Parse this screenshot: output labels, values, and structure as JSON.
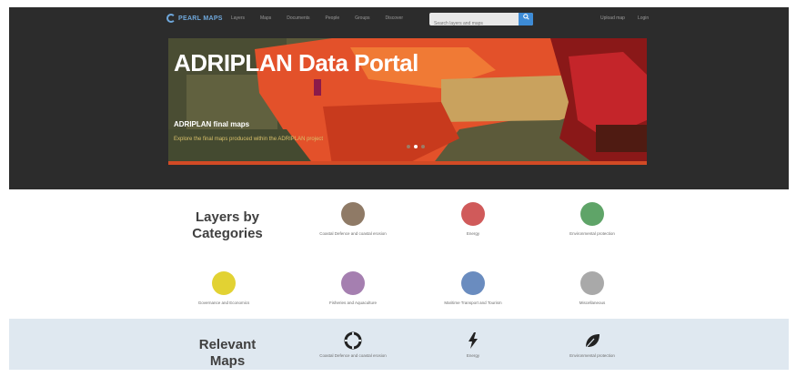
{
  "brand": {
    "name": "PEARL MAPS"
  },
  "nav": {
    "items": [
      "Layers",
      "Maps",
      "Documents",
      "People",
      "Groups",
      "Discover"
    ]
  },
  "search": {
    "placeholder": "Search layers and maps",
    "icon": "search-icon"
  },
  "user_links": [
    "Upload map",
    "Login"
  ],
  "hero": {
    "title": "ADRIPLAN Data Portal",
    "subtitle": "ADRIPLAN final maps",
    "caption": "Explore the final maps produced within the ADRIPLAN project",
    "slides_count": 3,
    "active_slide": 2
  },
  "categories": {
    "title_line1": "Layers by",
    "title_line2": "Categories",
    "items": [
      {
        "label": "Coastal Defence and coastal erosion",
        "color": "#8f7a66"
      },
      {
        "label": "Energy",
        "color": "#d05a5a"
      },
      {
        "label": "Environmental protection",
        "color": "#5fa468"
      },
      {
        "label": "Governance and Economics",
        "color": "#e2d233"
      },
      {
        "label": "Fisheries and Aquaculture",
        "color": "#a57fb0"
      },
      {
        "label": "Maritime Transport and Tourism",
        "color": "#6a8cbf"
      },
      {
        "label": "Miscellaneous",
        "color": "#a9a9a9"
      }
    ]
  },
  "maps": {
    "title_line1": "Relevant",
    "title_line2": "Maps",
    "items": [
      {
        "label": "Coastal Defence and coastal erosion",
        "icon": "lifebuoy-icon"
      },
      {
        "label": "Energy",
        "icon": "lightning-icon"
      },
      {
        "label": "Environmental protection",
        "icon": "leaf-icon"
      }
    ]
  }
}
